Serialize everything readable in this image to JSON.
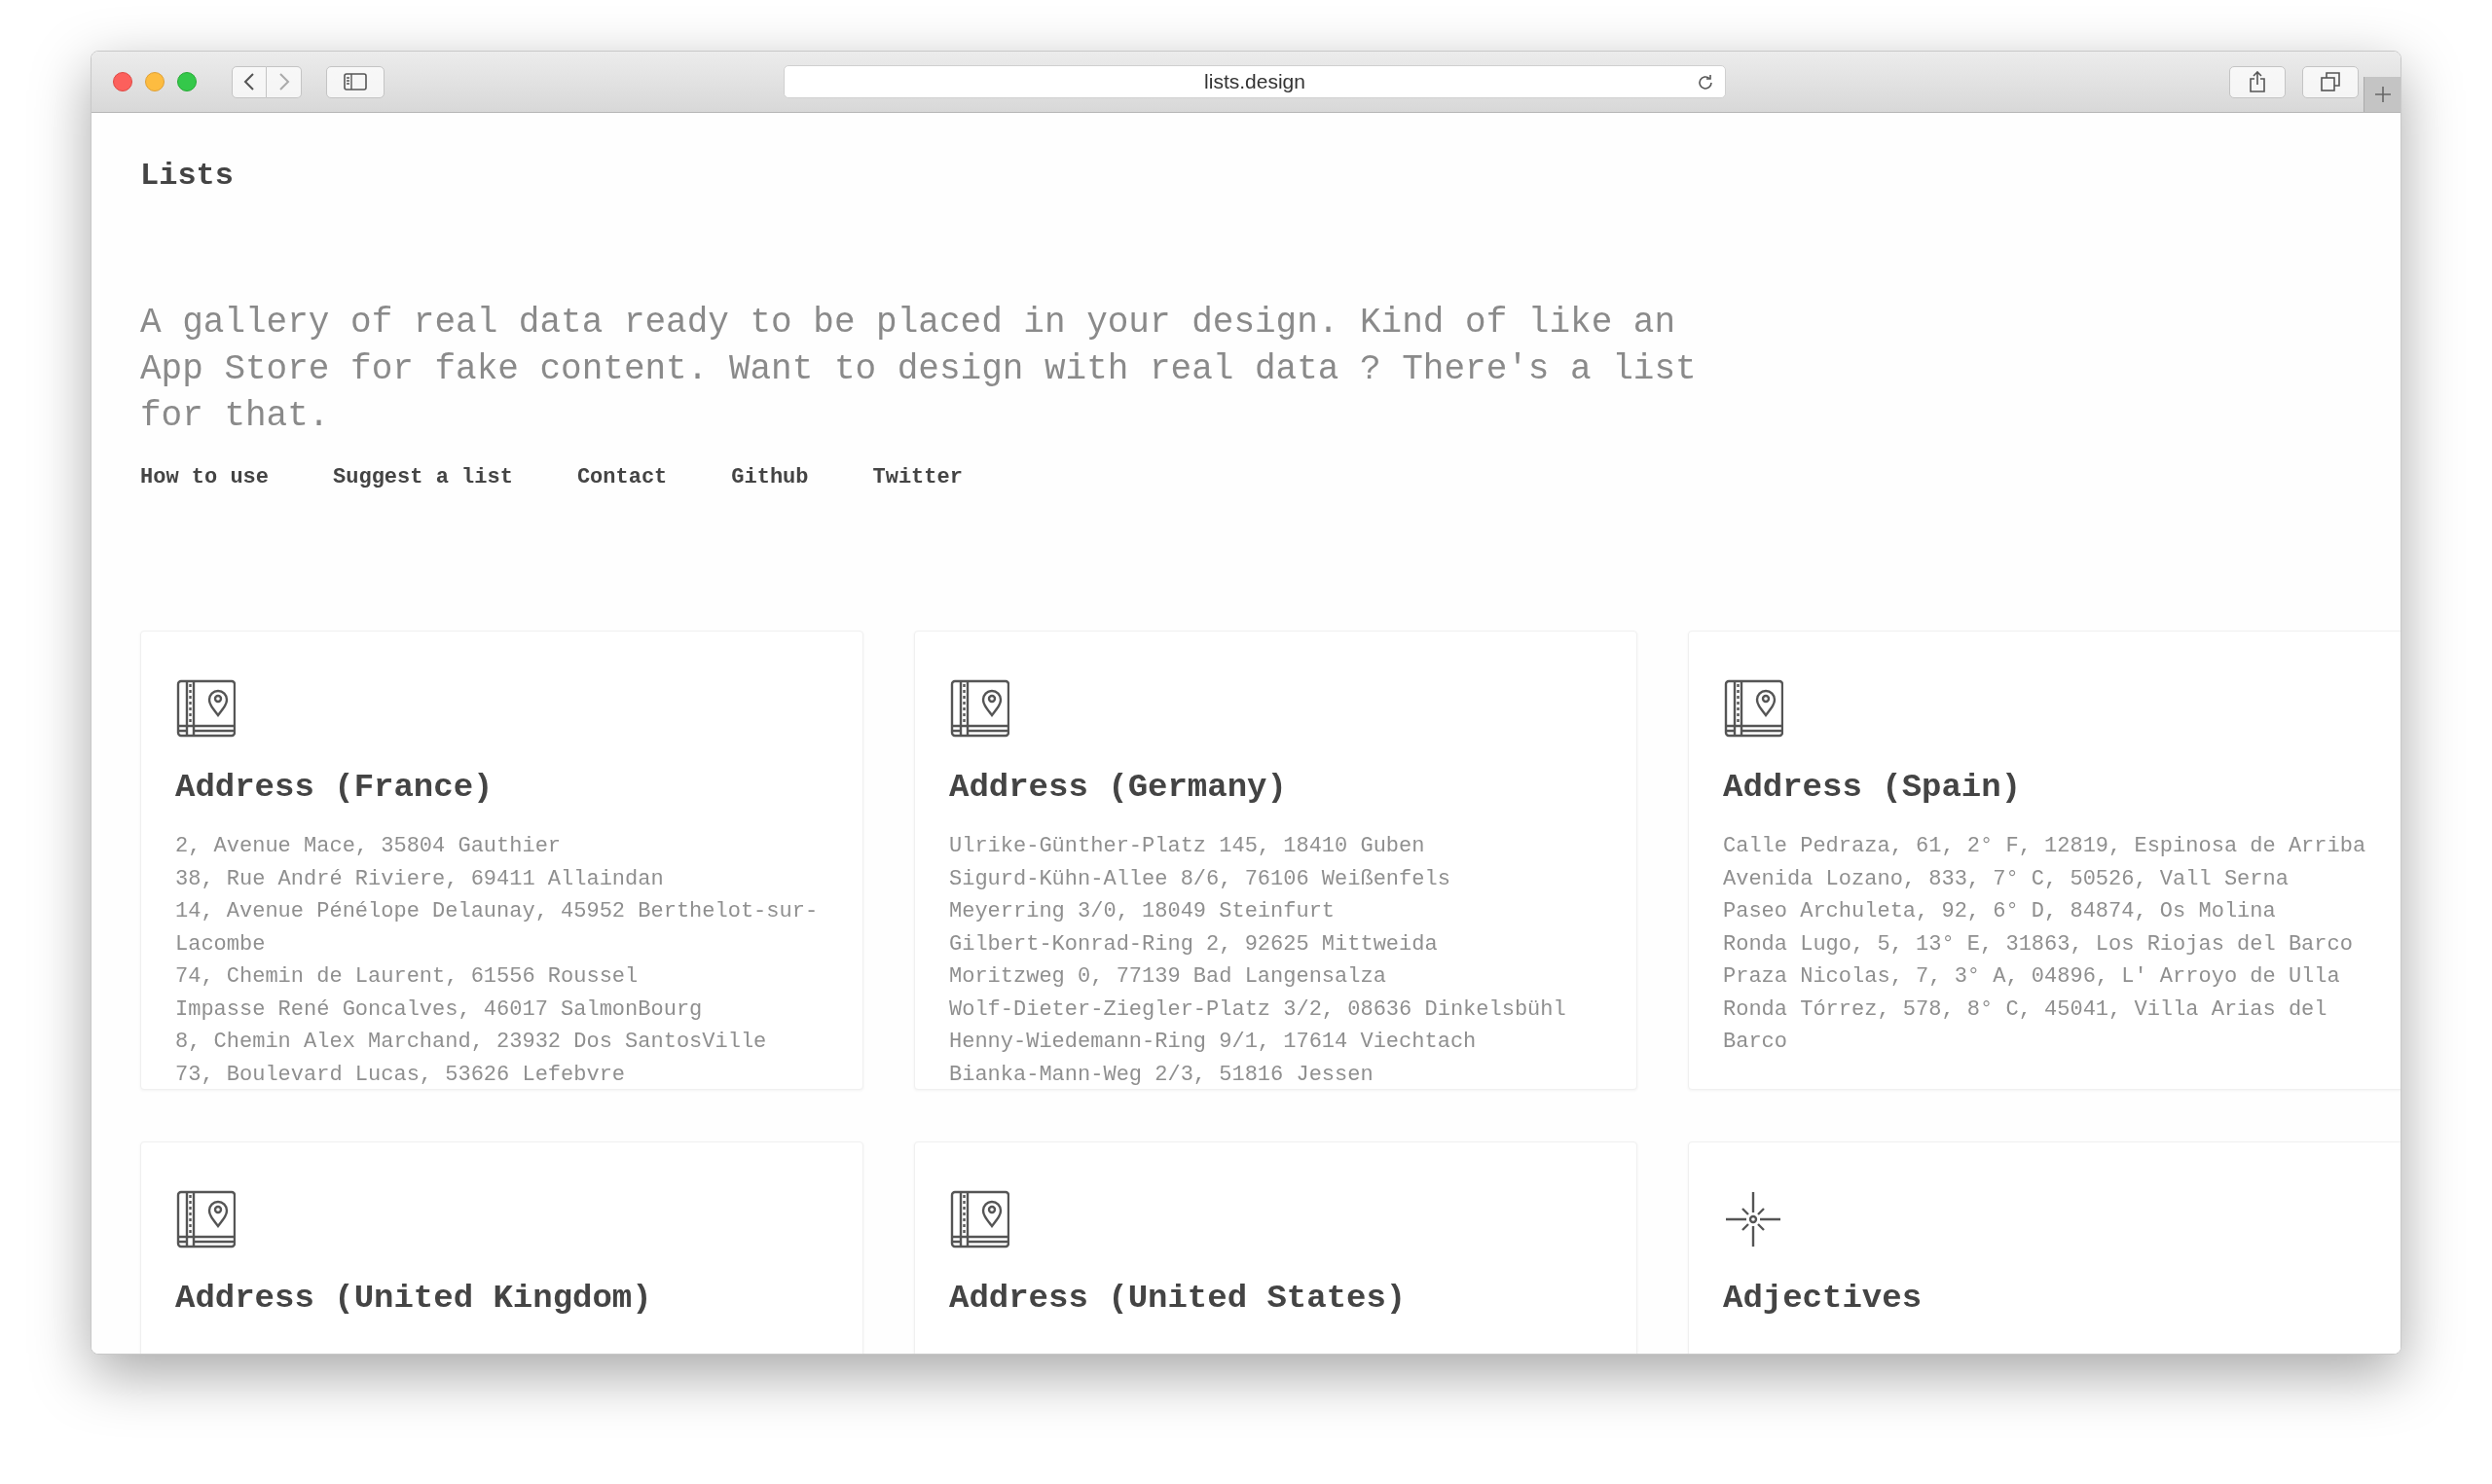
{
  "browser": {
    "url": "lists.design"
  },
  "page": {
    "logo": "Lists",
    "description": "A gallery of real data ready to be placed in your design. Kind of like an App Store for fake content. Want to design with real data ? There's a list for that.",
    "nav": [
      "How to use",
      "Suggest a list",
      "Contact",
      "Github",
      "Twitter"
    ]
  },
  "cards": [
    {
      "kind": "address",
      "title": "Address (France)",
      "lines": [
        "2, Avenue Mace, 35804 Gauthier",
        "38, Rue André Riviere, 69411 Allaindan",
        "14, Avenue Pénélope Delaunay, 45952 Berthelot-sur-Lacombe",
        "74, Chemin de Laurent, 61556 Roussel",
        "Impasse René Goncalves, 46017 SalmonBourg",
        "8, Chemin Alex Marchand, 23932 Dos SantosVille",
        "73, Boulevard Lucas, 53626 Lefebvre"
      ]
    },
    {
      "kind": "address",
      "title": "Address (Germany)",
      "lines": [
        "Ulrike-Günther-Platz 145, 18410 Guben",
        "Sigurd-Kühn-Allee 8/6, 76106 Weißenfels",
        "Meyerring 3/0, 18049 Steinfurt",
        "Gilbert-Konrad-Ring 2, 92625 Mittweida",
        "Moritzweg 0, 77139 Bad Langensalza",
        "Wolf-Dieter-Ziegler-Platz 3/2, 08636 Dinkelsbühl",
        "Henny-Wiedemann-Ring 9/1, 17614 Viechtach",
        "Bianka-Mann-Weg 2/3, 51816 Jessen"
      ]
    },
    {
      "kind": "address",
      "title": "Address (Spain)",
      "lines": [
        "Calle Pedraza, 61, 2° F, 12819, Espinosa de Arriba",
        "Avenida Lozano, 833, 7° C, 50526, Vall Serna",
        "Paseo Archuleta, 92, 6° D, 84874, Os Molina",
        "Ronda Lugo, 5, 13° E, 31863, Los Riojas del Barco",
        "Praza Nicolas, 7, 3° A, 04896, L' Arroyo de Ulla",
        "Ronda Tórrez, 578, 8° C, 45041, Villa Arias del Barco"
      ]
    },
    {
      "kind": "address",
      "title": "Address (United Kingdom)"
    },
    {
      "kind": "address",
      "title": "Address (United States)"
    },
    {
      "kind": "sparkle",
      "title": "Adjectives"
    }
  ]
}
